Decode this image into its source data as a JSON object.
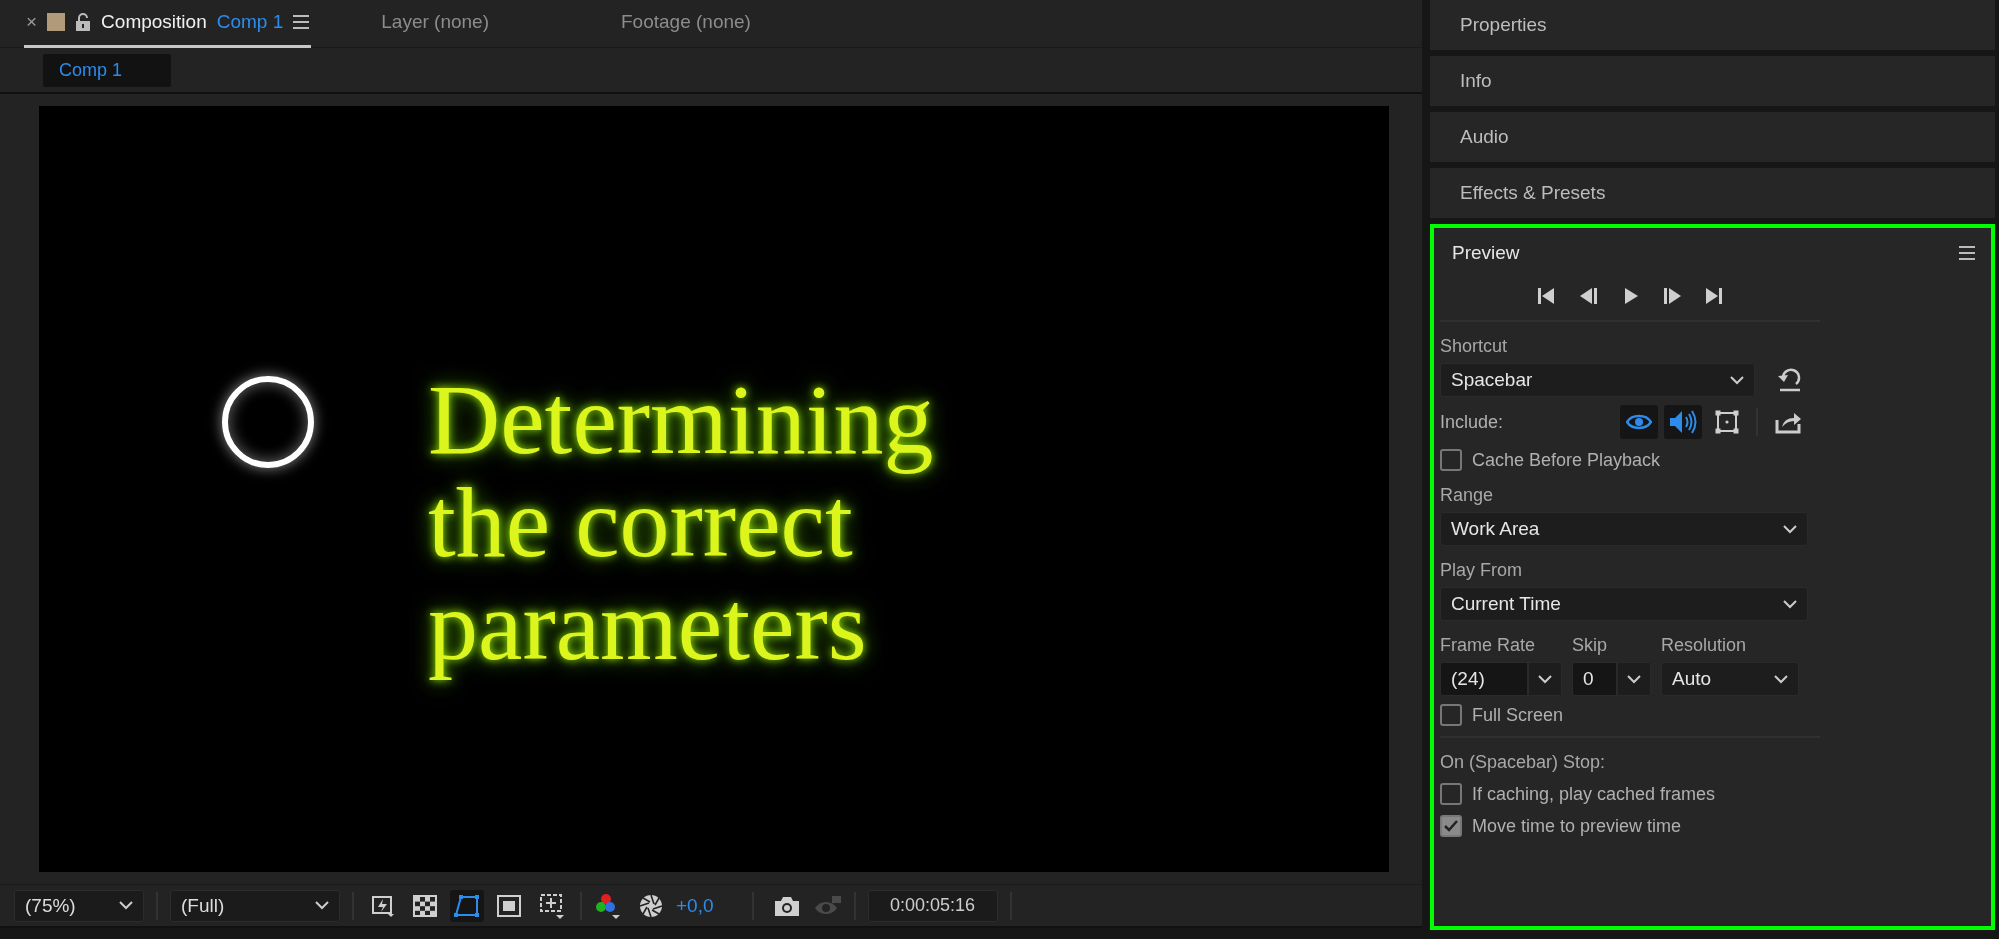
{
  "composition_panel": {
    "tabs": [
      {
        "kind": "comp",
        "label": "Composition",
        "name": "Comp 1",
        "selected": true
      },
      {
        "kind": "plain",
        "label": "Layer (none)",
        "selected": false
      },
      {
        "kind": "plain",
        "label": "Footage (none)",
        "selected": false
      }
    ],
    "close_glyph": "×",
    "breadcrumb": "Comp 1",
    "viewer": {
      "lines": [
        "Determining",
        "the correct",
        "parameters"
      ]
    },
    "toolbar": {
      "zoom": "(75%)",
      "resolution": "(Full)",
      "view_buttons": [
        {
          "kind": "fast-previews",
          "selected": false
        },
        {
          "kind": "transparency",
          "selected": false
        },
        {
          "kind": "mask",
          "selected": true
        },
        {
          "kind": "safe-zones",
          "selected": false
        },
        {
          "kind": "grid",
          "selected": false
        }
      ],
      "exposure": "+0,0",
      "timecode": "0:00:05:16"
    }
  },
  "side_panels": [
    "Properties",
    "Info",
    "Audio",
    "Effects & Presets"
  ],
  "preview": {
    "title": "Preview",
    "shortcut_label": "Shortcut",
    "shortcut": "Spacebar",
    "include_label": "Include:",
    "include": [
      {
        "kind": "video",
        "on": true
      },
      {
        "kind": "audio",
        "on": true
      },
      {
        "kind": "overlay",
        "on": false
      }
    ],
    "cache_before_playback": {
      "label": "Cache Before Playback",
      "checked": false
    },
    "range_label": "Range",
    "range": "Work Area",
    "play_from_label": "Play From",
    "play_from": "Current Time",
    "frame_rate_label": "Frame Rate",
    "frame_rate": "(24)",
    "skip_label": "Skip",
    "skip": "0",
    "resolution_label": "Resolution",
    "resolution": "Auto",
    "full_screen": {
      "label": "Full Screen",
      "checked": false
    },
    "stop_label": "On (Spacebar) Stop:",
    "stop_options": [
      {
        "label": "If caching, play cached frames",
        "checked": false
      },
      {
        "label": "Move time to preview time",
        "checked": true
      }
    ]
  }
}
